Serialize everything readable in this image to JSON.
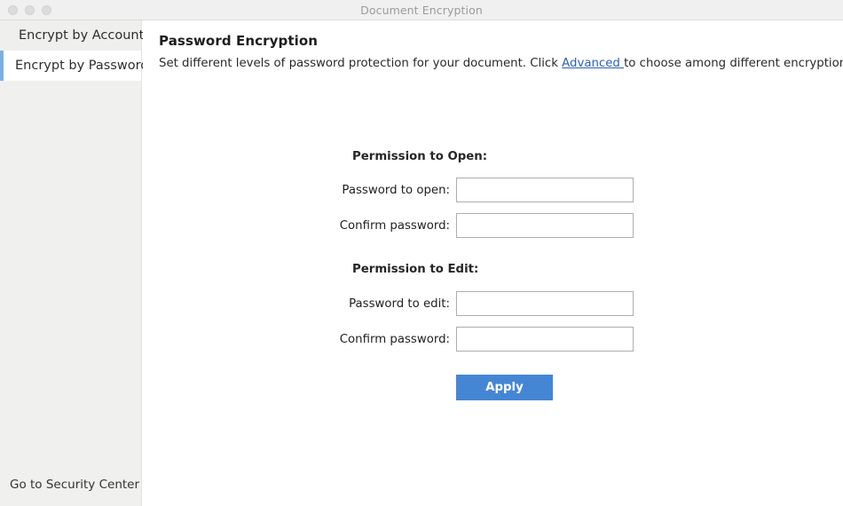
{
  "window": {
    "title": "Document Encryption",
    "traffic_lights": [
      "close",
      "minimize",
      "maximize"
    ]
  },
  "sidebar": {
    "items": [
      {
        "label": "Encrypt by Account",
        "active": false
      },
      {
        "label": "Encrypt by Password",
        "active": true
      }
    ],
    "footer_link": {
      "label": "Go to Security Center",
      "chevron": "›"
    }
  },
  "main": {
    "title": "Password Encryption",
    "description": {
      "before_link": "Set different levels of password protection for your document. Click ",
      "link_label": "Advanced ",
      "after_link": "to choose among different encryption types."
    },
    "sections": [
      {
        "heading": "Permission to Open:",
        "fields": [
          {
            "label": "Password to open:",
            "value": "",
            "placeholder": ""
          },
          {
            "label": "Confirm password:",
            "value": "",
            "placeholder": ""
          }
        ]
      },
      {
        "heading": "Permission to Edit:",
        "fields": [
          {
            "label": "Password to edit:",
            "value": "",
            "placeholder": ""
          },
          {
            "label": "Confirm password:",
            "value": "",
            "placeholder": ""
          }
        ]
      }
    ],
    "apply_button": "Apply"
  },
  "colors": {
    "accent_blue": "#4586d4",
    "selection_bar": "#7bafe2",
    "link_blue": "#2b5fbb",
    "sidebar_bg": "#f0f0ef",
    "titlebar_bg": "#f0f0f0"
  }
}
